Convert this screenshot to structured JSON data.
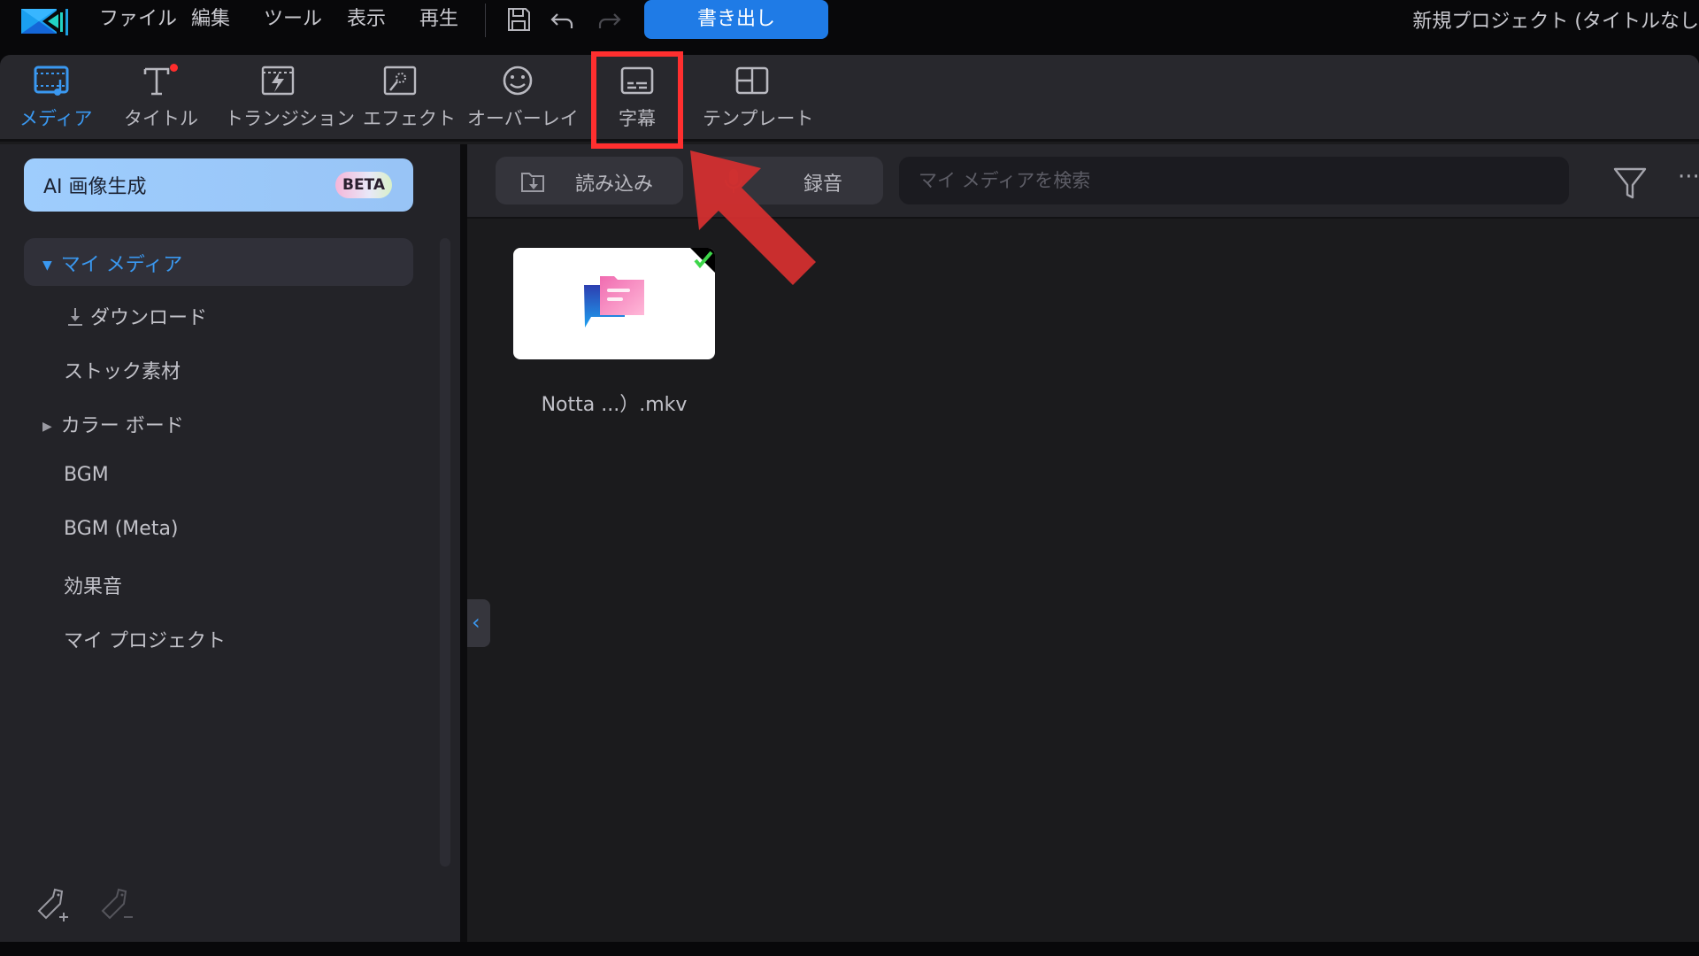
{
  "menubar": {
    "menus": [
      "ファイル",
      "編集",
      "ツール",
      "表示",
      "再生"
    ],
    "export_label": "書き出し",
    "project_title": "新規プロジェクト (タイトルなし",
    "icons": [
      "save-icon",
      "undo-icon",
      "redo-icon"
    ]
  },
  "categories": [
    {
      "label": "メディア",
      "icon": "media-icon",
      "active": true
    },
    {
      "label": "タイトル",
      "icon": "title-icon",
      "badge": "new-dot"
    },
    {
      "label": "トランジション",
      "icon": "transition-icon"
    },
    {
      "label": "エフェクト",
      "icon": "effect-icon"
    },
    {
      "label": "オーバーレイ",
      "icon": "overlay-icon"
    },
    {
      "label": "字幕",
      "icon": "subtitle-icon",
      "highlighted": true
    },
    {
      "label": "テンプレート",
      "icon": "template-icon"
    }
  ],
  "sidebar": {
    "ai_button_label": "AI 画像生成",
    "ai_badge": "BETA",
    "items": [
      {
        "label": "マイ メディア",
        "caret": "▼",
        "active": true
      },
      {
        "label": "ダウンロード",
        "icon": "download-icon"
      },
      {
        "label": "ストック素材"
      },
      {
        "label": "カラー ボード",
        "caret": "▶"
      },
      {
        "label": "BGM"
      },
      {
        "label": "BGM (Meta)"
      },
      {
        "label": "効果音"
      },
      {
        "label": "マイ プロジェクト"
      }
    ],
    "footer_icons": [
      "add-tag-icon",
      "remove-tag-icon"
    ]
  },
  "media_toolbar": {
    "import_label": "読み込み",
    "record_label": "録音",
    "search_placeholder": "マイ メディアを検索",
    "more_label": "···"
  },
  "media": {
    "items": [
      {
        "name": "Notta ...）.mkv",
        "checked": true
      }
    ],
    "collapse_glyph": "‹"
  },
  "colors": {
    "accent": "#3a98f0",
    "export": "#1f7be6",
    "highlight": "#ff2f2f",
    "annotation_arrow": "#d32f2f"
  }
}
